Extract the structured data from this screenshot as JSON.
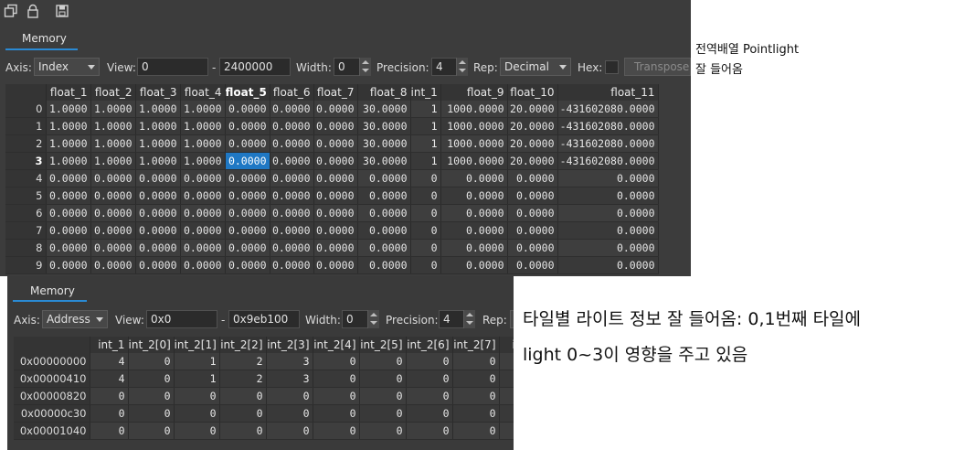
{
  "panel1": {
    "tab_label": "Memory",
    "toolbar": {
      "axis_label": "Axis:",
      "axis_value": "Index",
      "view_label": "View:",
      "view_start": "0",
      "view_sep": "-",
      "view_end": "2400000",
      "width_label": "Width:",
      "width_value": "0",
      "precision_label": "Precision:",
      "precision_value": "4",
      "rep_label": "Rep:",
      "rep_value": "Decimal",
      "hex_label": "Hex:",
      "transpose_label": "Transpose"
    },
    "columns": [
      "float_1",
      "float_2",
      "float_3",
      "float_4",
      "float_5",
      "float_6",
      "float_7",
      "float_8",
      "int_1",
      "float_9",
      "float_10",
      "float_11"
    ],
    "bold_column": "float_5",
    "selected_row": "3",
    "rows": [
      {
        "idx": "0",
        "cells": [
          "1.0000",
          "1.0000",
          "1.0000",
          "1.0000",
          "0.0000",
          "0.0000",
          "0.0000",
          "30.0000",
          "1",
          "1000.0000",
          "20.0000",
          "-431602080.0000"
        ]
      },
      {
        "idx": "1",
        "cells": [
          "1.0000",
          "1.0000",
          "1.0000",
          "1.0000",
          "0.0000",
          "0.0000",
          "0.0000",
          "30.0000",
          "1",
          "1000.0000",
          "20.0000",
          "-431602080.0000"
        ]
      },
      {
        "idx": "2",
        "cells": [
          "1.0000",
          "1.0000",
          "1.0000",
          "1.0000",
          "0.0000",
          "0.0000",
          "0.0000",
          "30.0000",
          "1",
          "1000.0000",
          "20.0000",
          "-431602080.0000"
        ]
      },
      {
        "idx": "3",
        "cells": [
          "1.0000",
          "1.0000",
          "1.0000",
          "1.0000",
          "0.0000",
          "0.0000",
          "0.0000",
          "30.0000",
          "1",
          "1000.0000",
          "20.0000",
          "-431602080.0000"
        ]
      },
      {
        "idx": "4",
        "cells": [
          "0.0000",
          "0.0000",
          "0.0000",
          "0.0000",
          "0.0000",
          "0.0000",
          "0.0000",
          "0.0000",
          "0",
          "0.0000",
          "0.0000",
          "0.0000"
        ]
      },
      {
        "idx": "5",
        "cells": [
          "0.0000",
          "0.0000",
          "0.0000",
          "0.0000",
          "0.0000",
          "0.0000",
          "0.0000",
          "0.0000",
          "0",
          "0.0000",
          "0.0000",
          "0.0000"
        ]
      },
      {
        "idx": "6",
        "cells": [
          "0.0000",
          "0.0000",
          "0.0000",
          "0.0000",
          "0.0000",
          "0.0000",
          "0.0000",
          "0.0000",
          "0",
          "0.0000",
          "0.0000",
          "0.0000"
        ]
      },
      {
        "idx": "7",
        "cells": [
          "0.0000",
          "0.0000",
          "0.0000",
          "0.0000",
          "0.0000",
          "0.0000",
          "0.0000",
          "0.0000",
          "0",
          "0.0000",
          "0.0000",
          "0.0000"
        ]
      },
      {
        "idx": "8",
        "cells": [
          "0.0000",
          "0.0000",
          "0.0000",
          "0.0000",
          "0.0000",
          "0.0000",
          "0.0000",
          "0.0000",
          "0",
          "0.0000",
          "0.0000",
          "0.0000"
        ]
      },
      {
        "idx": "9",
        "cells": [
          "0.0000",
          "0.0000",
          "0.0000",
          "0.0000",
          "0.0000",
          "0.0000",
          "0.0000",
          "0.0000",
          "0",
          "0.0000",
          "0.0000",
          "0.0000"
        ]
      }
    ]
  },
  "panel2": {
    "tab_label": "Memory",
    "toolbar": {
      "axis_label": "Axis:",
      "axis_value": "Address",
      "view_label": "View:",
      "view_start": "0x0",
      "view_sep": "-",
      "view_end": "0x9eb100",
      "width_label": "Width:",
      "width_value": "0",
      "precision_label": "Precision:",
      "precision_value": "4",
      "rep_label": "Rep:"
    },
    "columns": [
      "int_1",
      "int_2[0]",
      "int_2[1]",
      "int_2[2]",
      "int_2[3]",
      "int_2[4]",
      "int_2[5]",
      "int_2[6]",
      "int_2[7]",
      "in"
    ],
    "rows": [
      {
        "idx": "0x00000000",
        "cells": [
          "4",
          "0",
          "1",
          "2",
          "3",
          "0",
          "0",
          "0",
          "0",
          ""
        ]
      },
      {
        "idx": "0x00000410",
        "cells": [
          "4",
          "0",
          "1",
          "2",
          "3",
          "0",
          "0",
          "0",
          "0",
          ""
        ]
      },
      {
        "idx": "0x00000820",
        "cells": [
          "0",
          "0",
          "0",
          "0",
          "0",
          "0",
          "0",
          "0",
          "0",
          ""
        ]
      },
      {
        "idx": "0x00000c30",
        "cells": [
          "0",
          "0",
          "0",
          "0",
          "0",
          "0",
          "0",
          "0",
          "0",
          ""
        ]
      },
      {
        "idx": "0x00001040",
        "cells": [
          "0",
          "0",
          "0",
          "0",
          "0",
          "0",
          "0",
          "0",
          "0",
          ""
        ]
      }
    ]
  },
  "notes": {
    "note1_line1": "전역배열 Pointlight",
    "note1_line2": "잘 들어옴",
    "note2_line1": "타일별 라이트 정보 잘 들어옴: 0,1번째 타일에",
    "note2_line2": "light 0~3이 영향을 주고 있음"
  },
  "icons": [
    "copy-icon",
    "lock-icon",
    "save-icon"
  ],
  "colors": {
    "panel_bg": "#3c3c3c",
    "accent": "#2a8ad4",
    "selection": "#1f78c4"
  }
}
